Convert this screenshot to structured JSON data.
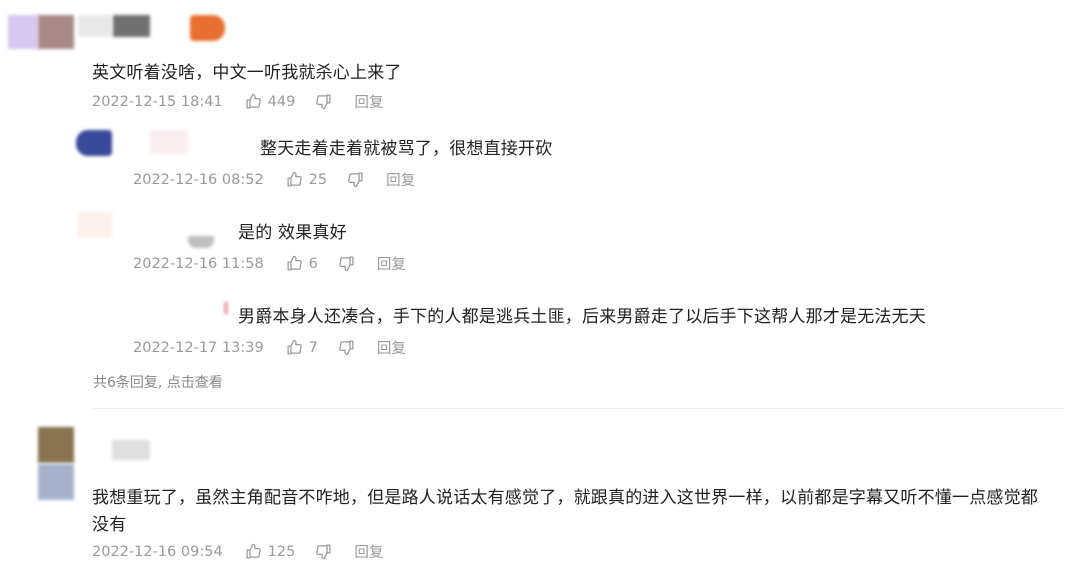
{
  "comments": [
    {
      "text": "英文听着没啥，中文一听我就杀心上来了",
      "time": "2022-12-15 18:41",
      "likes": "449",
      "reply_label": "回复",
      "replies": [
        {
          "text": "整天走着走着就被骂了，很想直接开砍",
          "time": "2022-12-16 08:52",
          "likes": "25",
          "reply_label": "回复"
        },
        {
          "text": "是的 效果真好",
          "time": "2022-12-16 11:58",
          "likes": "6",
          "reply_label": "回复"
        },
        {
          "text": "男爵本身人还凑合，手下的人都是逃兵土匪，后来男爵走了以后手下这帮人那才是无法无天",
          "time": "2022-12-17 13:39",
          "likes": "7",
          "reply_label": "回复"
        }
      ],
      "more_replies": "共6条回复, 点击查看"
    },
    {
      "text_line1": "我想重玩了，虽然主角配音不咋地，但是路人说话太有感觉了，就跟真的进入这世界一样，以前都是字幕又听不懂一点感觉都",
      "text_line2": "没有",
      "time": "2022-12-16 09:54",
      "likes": "125",
      "reply_label": "回复"
    }
  ],
  "icons": {
    "like": "thumbs-up-icon",
    "dislike": "thumbs-down-icon"
  },
  "colors": {
    "meta": "#9a9a9a",
    "divider": "#ececec"
  }
}
